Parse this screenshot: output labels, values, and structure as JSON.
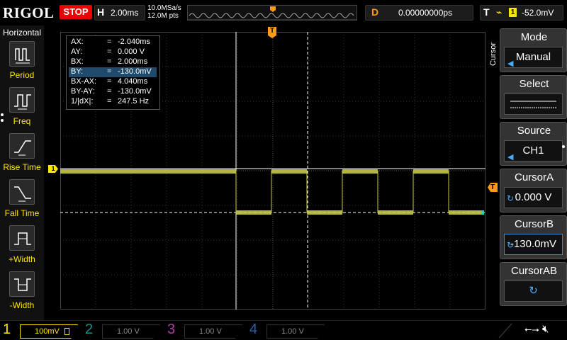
{
  "topbar": {
    "brand": "RIGOL",
    "run_state": "STOP",
    "timebase_letter": "H",
    "timebase_value": "2.00ms",
    "sample_rate": "10.0MSa/s",
    "memory_depth": "12.0M pts",
    "delay_letter": "D",
    "delay_value": "0.00000000ps",
    "trigger_letter": "T",
    "trigger_channel": "1",
    "trigger_level": "-52.0mV",
    "trigger_marker": "T"
  },
  "left_panel": {
    "title": "Horizontal",
    "items": [
      {
        "label": "Period",
        "icon": "period-icon"
      },
      {
        "label": "Freq",
        "icon": "freq-icon"
      },
      {
        "label": "Rise Time",
        "icon": "rise-time-icon"
      },
      {
        "label": "Fall Time",
        "icon": "fall-time-icon"
      },
      {
        "label": "+Width",
        "icon": "positive-width-icon"
      },
      {
        "label": "-Width",
        "icon": "negative-width-icon"
      }
    ]
  },
  "readout": {
    "rows": [
      {
        "label": "AX:",
        "eq": "=",
        "value": "-2.040ms"
      },
      {
        "label": "AY:",
        "eq": "=",
        "value": "0.000 V"
      },
      {
        "label": "BX:",
        "eq": "=",
        "value": "2.000ms"
      },
      {
        "label": "BY:",
        "eq": "=",
        "value": "-130.0mV"
      },
      {
        "label": "BX-AX:",
        "eq": "=",
        "value": "4.040ms"
      },
      {
        "label": "BY-AY:",
        "eq": "=",
        "value": "-130.0mV"
      },
      {
        "label": "1/|dX|:",
        "eq": "=",
        "value": "247.5 Hz"
      }
    ]
  },
  "waveform": {
    "ch1_marker": "1",
    "trigger_marker": "T",
    "trace_color": "#d8d84a",
    "grid_color": "#3a3a3a"
  },
  "right_menu": {
    "side_title": "Cursor",
    "mode": {
      "title": "Mode",
      "value": "Manual"
    },
    "select": {
      "title": "Select"
    },
    "source": {
      "title": "Source",
      "value": "CH1"
    },
    "cursor_a": {
      "title": "CursorA",
      "value": "0.000 V"
    },
    "cursor_b": {
      "title": "CursorB",
      "value": "-130.0mV"
    },
    "cursor_ab": {
      "title": "CursorAB"
    }
  },
  "channels": [
    {
      "num": "1",
      "scale": "100mV",
      "color": "#ffe600",
      "active": true
    },
    {
      "num": "2",
      "scale": "1.00 V",
      "color": "#1a8c8c",
      "active": false
    },
    {
      "num": "3",
      "scale": "1.00 V",
      "color": "#b03aa8",
      "active": false
    },
    {
      "num": "4",
      "scale": "1.00 V",
      "color": "#2a5fb0",
      "active": false
    }
  ]
}
